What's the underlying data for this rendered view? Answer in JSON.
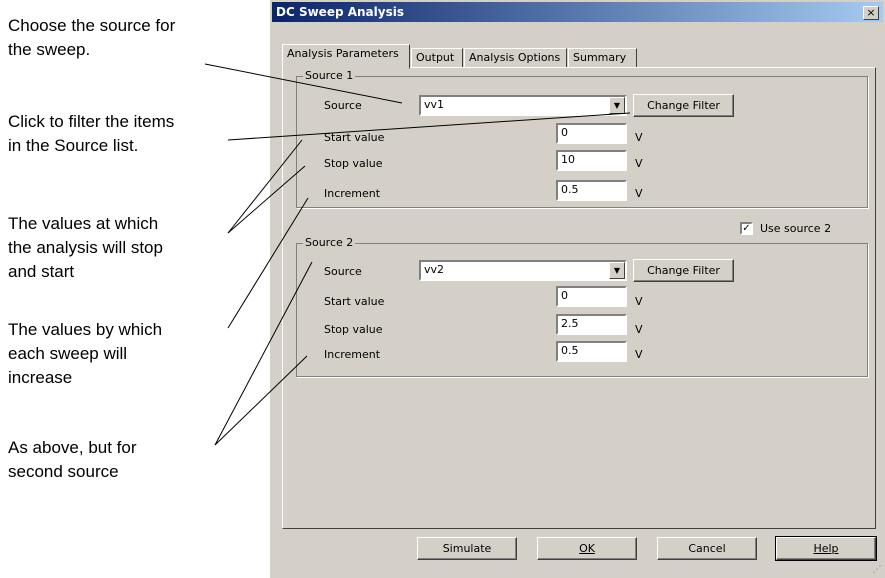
{
  "annotations": [
    "Choose the source for\nthe sweep.",
    "Click to filter the items\nin the Source list.",
    "The values at which\nthe analysis will stop\nand start",
    "The values by which\neach sweep will\nincrease",
    "As above, but for\nsecond source"
  ],
  "dialog": {
    "title": "DC Sweep Analysis",
    "close_glyph": "×",
    "tabs": [
      "Analysis Parameters",
      "Output",
      "Analysis Options",
      "Summary"
    ],
    "source1": {
      "title": "Source 1",
      "source_label": "Source",
      "source_value": "vv1",
      "filter_button": "Change Filter",
      "start_label": "Start value",
      "start_value": "0",
      "stop_label": "Stop value",
      "stop_value": "10",
      "increment_label": "Increment",
      "increment_value": "0.5",
      "unit": "V"
    },
    "use_source2": {
      "label": "Use source 2",
      "checked": true,
      "mark": "✓"
    },
    "source2": {
      "title": "Source 2",
      "source_label": "Source",
      "source_value": "vv2",
      "filter_button": "Change Filter",
      "start_label": "Start value",
      "start_value": "0",
      "stop_label": "Stop value",
      "stop_value": "2.5",
      "increment_label": "Increment",
      "increment_value": "0.5",
      "unit": "V"
    },
    "buttons": {
      "simulate": "Simulate",
      "ok": "OK",
      "cancel": "Cancel",
      "help": "Help"
    },
    "dropdown_glyph": "▼",
    "grip_glyph": "⋰"
  }
}
